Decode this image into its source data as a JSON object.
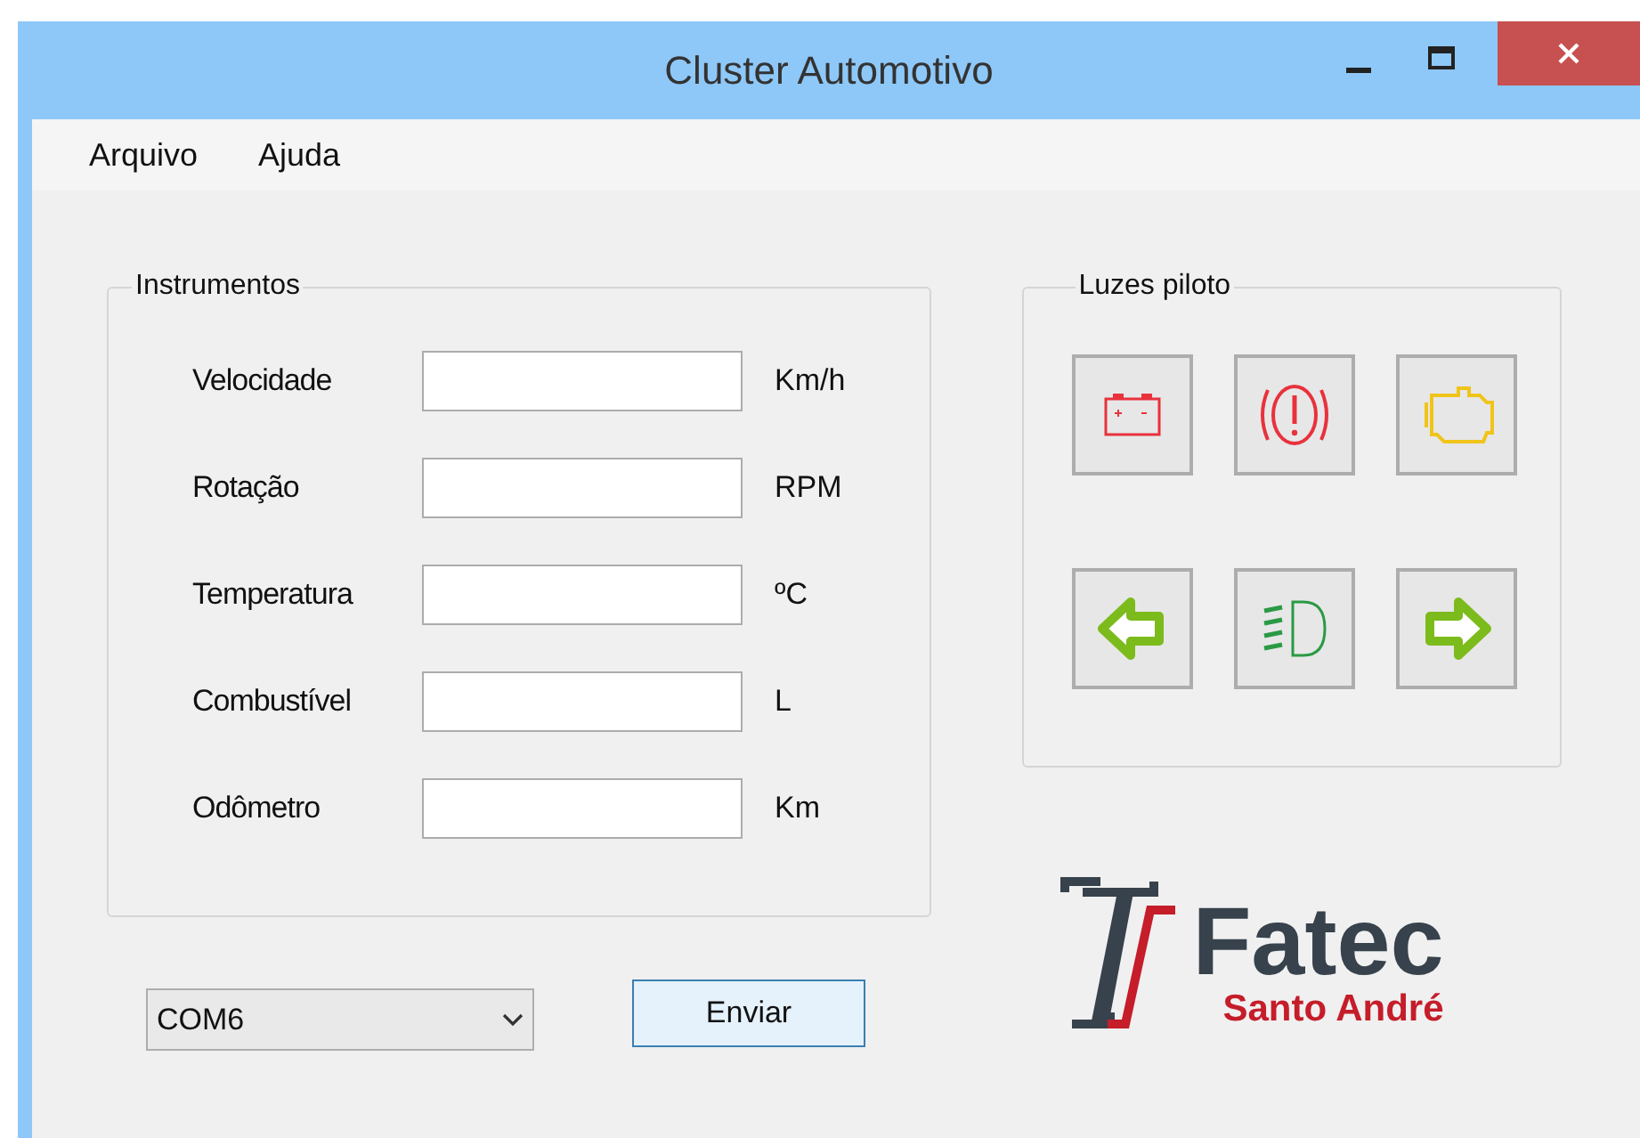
{
  "window": {
    "title": "Cluster Automotivo"
  },
  "menu": [
    "Arquivo",
    "Ajuda"
  ],
  "instruments": {
    "title": "Instrumentos",
    "rows": [
      {
        "label": "Velocidade",
        "unit": "Km/h"
      },
      {
        "label": "Rotação",
        "unit": "RPM"
      },
      {
        "label": "Temperatura",
        "unit": "ºC"
      },
      {
        "label": "Combustível",
        "unit": "L"
      },
      {
        "label": "Odômetro",
        "unit": "Km"
      }
    ]
  },
  "pilot_lights": {
    "title": "Luzes piloto",
    "lights": [
      {
        "kind": "battery"
      },
      {
        "kind": "brake"
      },
      {
        "kind": "engine"
      },
      {
        "kind": "left"
      },
      {
        "kind": "headlight"
      },
      {
        "kind": "right"
      }
    ]
  },
  "port": {
    "value": "COM6"
  },
  "send_button": "Enviar",
  "logo": {
    "name": "Fatec",
    "subtitle": "Santo André"
  }
}
